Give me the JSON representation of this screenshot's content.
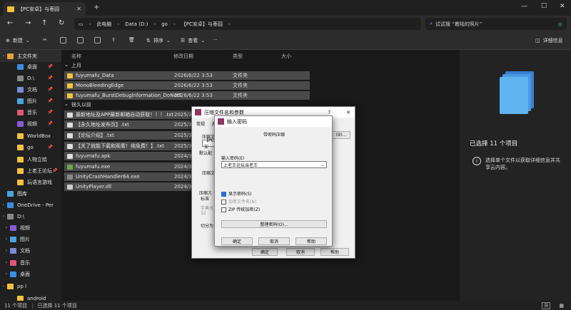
{
  "window": {
    "tab_title": "【PC安卓】与枣园",
    "new_tab": "+",
    "minimize": "—",
    "maximize": "☐",
    "close": "✕"
  },
  "address": {
    "crumbs": [
      "此电脑",
      "Data (D:)",
      "go",
      "【PC安卓】与枣园"
    ],
    "search_placeholder": "试试搜 “着陆的照片”"
  },
  "toolbar": {
    "new_label": "新建",
    "sort_label": "排序",
    "view_label": "查看",
    "more_label": "···",
    "details_label": "详细信息"
  },
  "sidebar": {
    "items": [
      {
        "label": "主文件夹",
        "color": "#e6a23c"
      },
      {
        "label": "桌面",
        "color": "#3a8ee6"
      },
      {
        "label": "D:\\",
        "color": "#888888"
      },
      {
        "label": "文档",
        "color": "#7a8bd6"
      },
      {
        "label": "图片",
        "color": "#4aa3df"
      },
      {
        "label": "音乐",
        "color": "#e0567a"
      },
      {
        "label": "视频",
        "color": "#8a5bd6"
      },
      {
        "label": "WorldBox",
        "color": "#f4c23c"
      },
      {
        "label": "go",
        "color": "#f4c23c"
      },
      {
        "label": "人物立绘",
        "color": "#f4c23c"
      },
      {
        "label": "上老王论坛",
        "color": "#f4c23c"
      },
      {
        "label": "玩语言游戏",
        "color": "#f4c23c"
      },
      {
        "label": "图库",
        "color": "#4aa3df"
      },
      {
        "label": "OneDrive - Per",
        "color": "#3a8ee6"
      },
      {
        "label": "D:\\",
        "color": "#888888"
      },
      {
        "label": "视频",
        "color": "#8a5bd6"
      },
      {
        "label": "图片",
        "color": "#4aa3df"
      },
      {
        "label": "文档",
        "color": "#7a8bd6"
      },
      {
        "label": "音乐",
        "color": "#e0567a"
      },
      {
        "label": "桌面",
        "color": "#3a8ee6"
      },
      {
        "label": "pp l",
        "color": "#f4c23c"
      },
      {
        "label": "android",
        "color": "#f4c23c"
      }
    ]
  },
  "files": {
    "columns": [
      "名称",
      "修改日期",
      "类型",
      "大小"
    ],
    "group1": "上月",
    "group2": "很久以前",
    "rows": [
      {
        "name": "fuyumafu_Data",
        "date": "2026/6/22 3:53",
        "type": "文件夹",
        "color": "#f4c23c"
      },
      {
        "name": "MonoBleedingEdge",
        "date": "2026/6/22 3:53",
        "type": "文件夹",
        "color": "#f4c23c"
      },
      {
        "name": "fuyumafu_BurstDebugInformation_DoNotS...",
        "date": "2026/6/22 3:53",
        "type": "文件夹",
        "color": "#f4c23c"
      },
      {
        "name": "最新地址及APP最新邮箱自动获取！！！.txt",
        "date": "2025/3",
        "type": "",
        "color": "#dddddd"
      },
      {
        "name": "【永久地址发布页】.txt",
        "date": "2025/3",
        "type": "",
        "color": "#dddddd"
      },
      {
        "name": "【论坛介绍】.txt",
        "date": "2025/3",
        "type": "",
        "color": "#dddddd"
      },
      {
        "name": "【关了就能下载和观看！纯免费！】.txt",
        "date": "2025/3",
        "type": "",
        "color": "#dddddd"
      },
      {
        "name": "fuyumafu.apk",
        "date": "2024/3",
        "type": "",
        "color": "#dddddd"
      },
      {
        "name": "fuyumafu.exe",
        "date": "2024/3",
        "type": "",
        "color": "#6aa84f"
      },
      {
        "name": "UnityCrashHandler64.exe",
        "date": "2024/3",
        "type": "",
        "color": "#888888"
      },
      {
        "name": "UnityPlayer.dll",
        "date": "2024/3",
        "type": "",
        "color": "#cccccc"
      }
    ]
  },
  "details": {
    "title": "已选择 11 个项目",
    "message": "选择单个文件以获取详细信息并共享云内容。"
  },
  "status": {
    "count": "11 个项目",
    "selected": "已选择 11 个项目"
  },
  "dialog_outer": {
    "title": "压缩文件名和参数",
    "help": "?",
    "tab": "常规",
    "tab2": "高",
    "label1": "压缩文",
    "label2": "默认配",
    "label3": "压缩文",
    "label4": "压缩方",
    "label5": "标准",
    "label6": "字典大",
    "label7": "32",
    "label8": "切分为",
    "prefix": "【PC安",
    "browse": "(B)...",
    "ok": "确定",
    "cancel": "取消",
    "helpbtn": "帮助"
  },
  "dialog_password": {
    "title": "输入密码",
    "heading": "带密码压缩",
    "field_label": "输入密码(E)",
    "field_value": "上老王论坛当老王",
    "show_password": "显示密码(S)",
    "encrypt_names": "加密文件名(N)",
    "zip_legacy": "ZIP 传统加密(Z)",
    "manage": "整理密码(O)...",
    "ok": "确定",
    "cancel": "取消",
    "help": "帮助"
  }
}
